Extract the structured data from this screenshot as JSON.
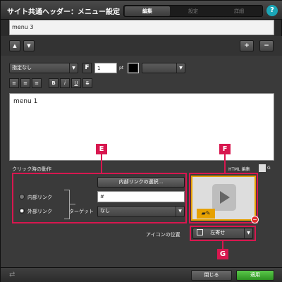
{
  "header": {
    "title": "サイト共通ヘッダー：メニュー設定",
    "tabs": [
      "編集",
      "設定",
      "詳細"
    ],
    "help_label": "?"
  },
  "menu_list": {
    "items": [
      "menu 3"
    ]
  },
  "list_controls": {
    "up": "▲",
    "down": "▼",
    "add": "+",
    "remove": "−"
  },
  "toolbar": {
    "font_select": "指定なし",
    "font_button": "F",
    "size_value": "1",
    "size_unit": "pt",
    "color_swatch": "#000000",
    "align_left": "≡",
    "align_center": "≡",
    "align_right": "≡",
    "bold": "B",
    "italic": "i",
    "underline": "U",
    "strike": "S"
  },
  "content": {
    "text": "menu 1"
  },
  "click_action": {
    "heading": "クリック時の動作",
    "internal_link_label": "内部リンク",
    "external_link_label": "外部リンク",
    "internal_link_button": "内部リンクの選択...",
    "url_value": "#",
    "target_label": "ターゲット",
    "target_value": "なし",
    "internal_selected": false,
    "external_selected": true
  },
  "html_edit": {
    "label": "HTML 編集",
    "icon_text": "G"
  },
  "icon_position": {
    "label": "アイコンの位置",
    "value": "左寄せ"
  },
  "markers": {
    "e": "E",
    "f": "F",
    "g": "G"
  },
  "footer": {
    "close": "閉じる",
    "apply": "適用"
  },
  "colors": {
    "accent_marker": "#d8174f",
    "apply_green": "#2e9322",
    "thumb_border": "#e6a100",
    "help": "#1aa6b7"
  }
}
